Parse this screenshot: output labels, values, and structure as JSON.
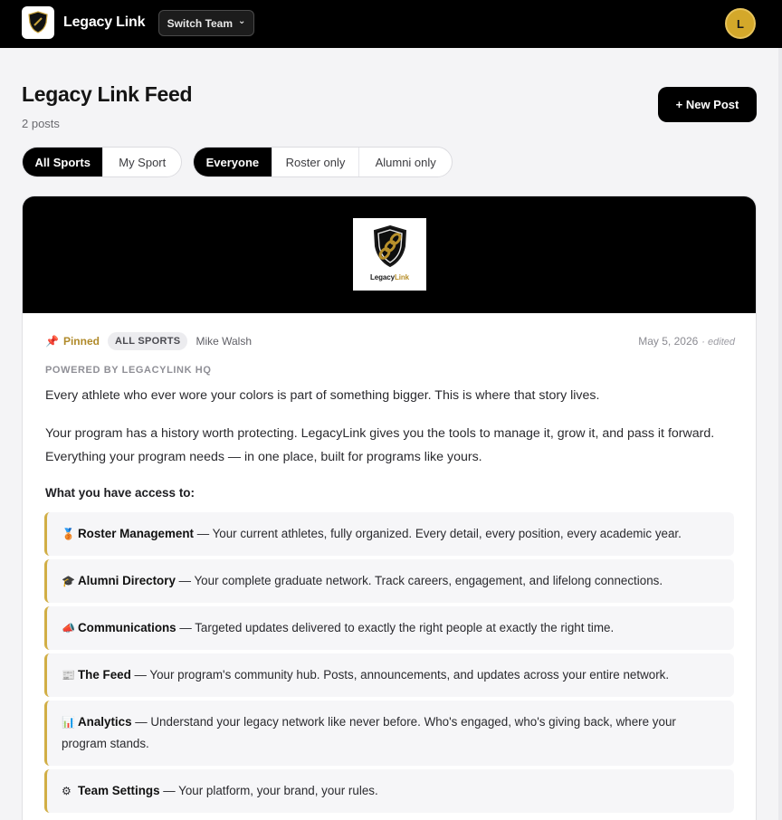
{
  "topbar": {
    "brand": "Legacy Link",
    "switch_team_label": "Switch Team",
    "switch_team_caret": "⌄",
    "avatar_initial": "L",
    "logo_text_a": "Legacy",
    "logo_text_b": "Link"
  },
  "page": {
    "title": "Legacy Link Feed",
    "post_count": "2 posts",
    "new_post_label": "+ New Post"
  },
  "filters": {
    "sport": [
      "All Sports",
      "My Sport"
    ],
    "audience": [
      "Everyone",
      "Roster only",
      "Alumni only"
    ]
  },
  "post": {
    "banner_logo_a": "Legacy",
    "banner_logo_b": "Link",
    "pinned_label": "Pinned",
    "sport_badge": "ALL SPORTS",
    "author": "Mike Walsh",
    "date": "May 5, 2026",
    "edited": "· edited",
    "eyebrow": "POWERED BY LEGACYLINK HQ",
    "intro": "Every athlete who ever wore your colors is part of something bigger. This is where that story lives.",
    "body": "Your program has a history worth protecting. LegacyLink gives you the tools to manage it, grow it, and pass it forward. Everything your program needs — in one place, built for programs like yours.",
    "section_heading": "What you have access to:",
    "features": [
      {
        "icon": "🥉",
        "title": "Roster Management",
        "text": " — Your current athletes, fully organized. Every detail, every position, every academic year."
      },
      {
        "icon": "🎓",
        "title": "Alumni Directory",
        "text": " — Your complete graduate network. Track careers, engagement, and lifelong connections."
      },
      {
        "icon": "📣",
        "title": "Communications",
        "text": " — Targeted updates delivered to exactly the right people at exactly the right time."
      },
      {
        "icon": "📰",
        "title": "The Feed",
        "text": " — Your program's community hub. Posts, announcements, and updates across your entire network."
      },
      {
        "icon": "📊",
        "title": "Analytics",
        "text": " — Understand your legacy network like never before. Who's engaged, who's giving back, where your program stands."
      },
      {
        "icon": "⚙",
        "title": "Team Settings",
        "text": " — Your platform, your brand, your rules."
      }
    ]
  },
  "colors": {
    "accent_gold": "#d1ae45",
    "topbar_bg": "#000000",
    "avatar_bg": "#d4a82a"
  }
}
